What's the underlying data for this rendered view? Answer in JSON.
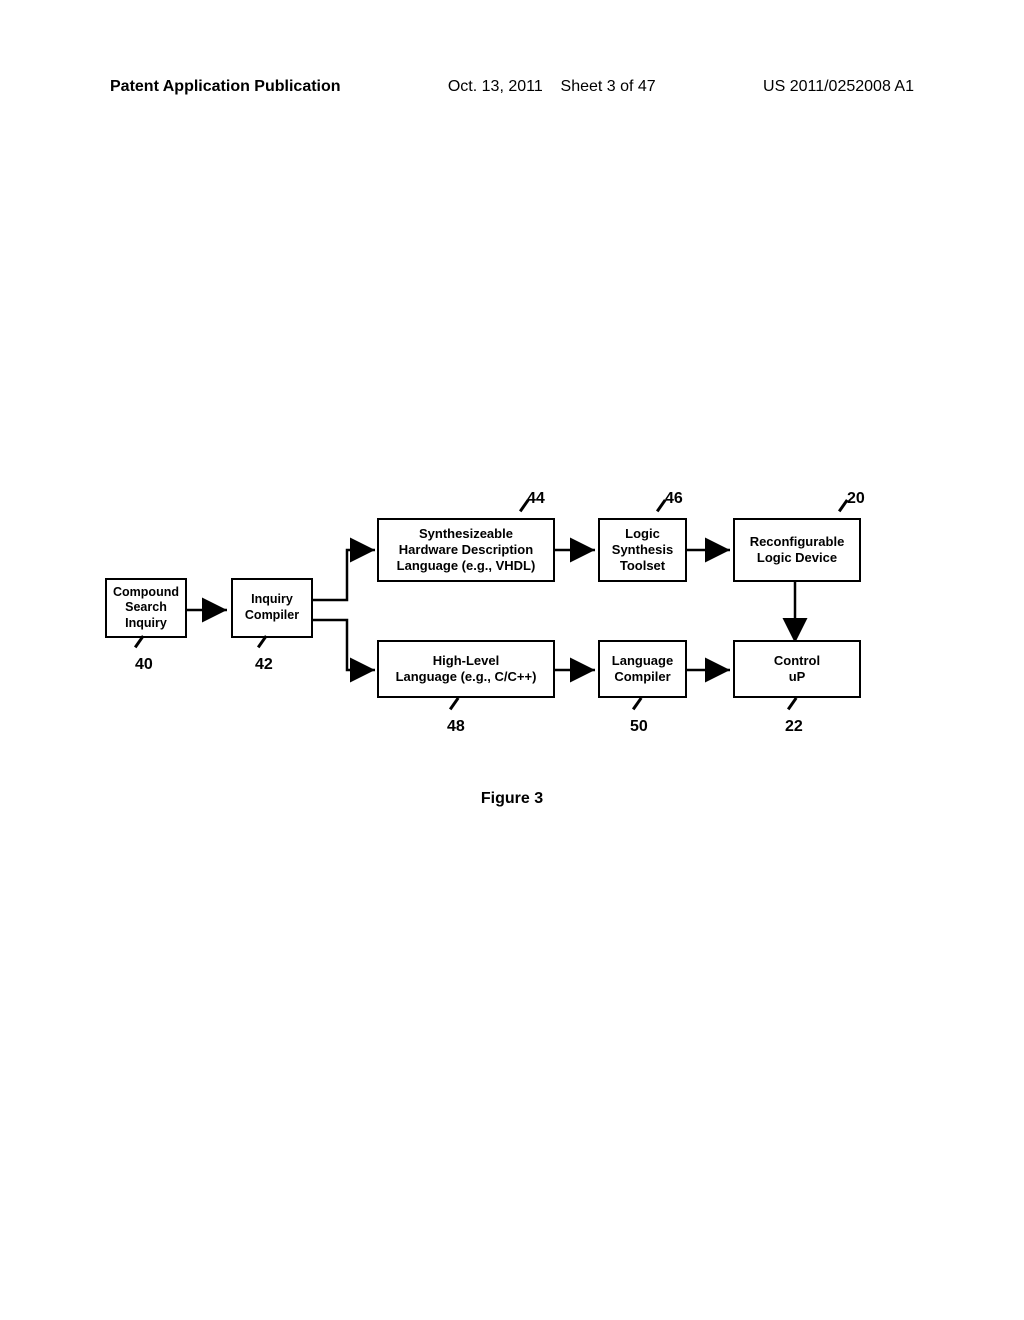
{
  "header": {
    "left": "Patent Application Publication",
    "mid_date": "Oct. 13, 2011",
    "mid_sheet": "Sheet 3 of 47",
    "right": "US 2011/0252008 A1"
  },
  "figure_caption": "Figure 3",
  "boxes": {
    "b40": {
      "line1": "Compound",
      "line2": "Search",
      "line3": "Inquiry"
    },
    "b42": {
      "line1": "Inquiry",
      "line2": "Compiler"
    },
    "b44": {
      "line1": "Synthesizeable",
      "line2": "Hardware Description",
      "line3": "Language (e.g., VHDL)"
    },
    "b46": {
      "line1": "Logic",
      "line2": "Synthesis",
      "line3": "Toolset"
    },
    "b20": {
      "line1": "Reconfigurable",
      "line2": "Logic Device"
    },
    "b48": {
      "line1": "High-Level",
      "line2": "Language (e.g., C/C++)"
    },
    "b50": {
      "line1": "Language",
      "line2": "Compiler"
    },
    "b22": {
      "line1": "Control",
      "line2": "uP"
    }
  },
  "refs": {
    "r40": "40",
    "r42": "42",
    "r44": "44",
    "r46": "46",
    "r20": "20",
    "r48": "48",
    "r50": "50",
    "r22": "22"
  }
}
